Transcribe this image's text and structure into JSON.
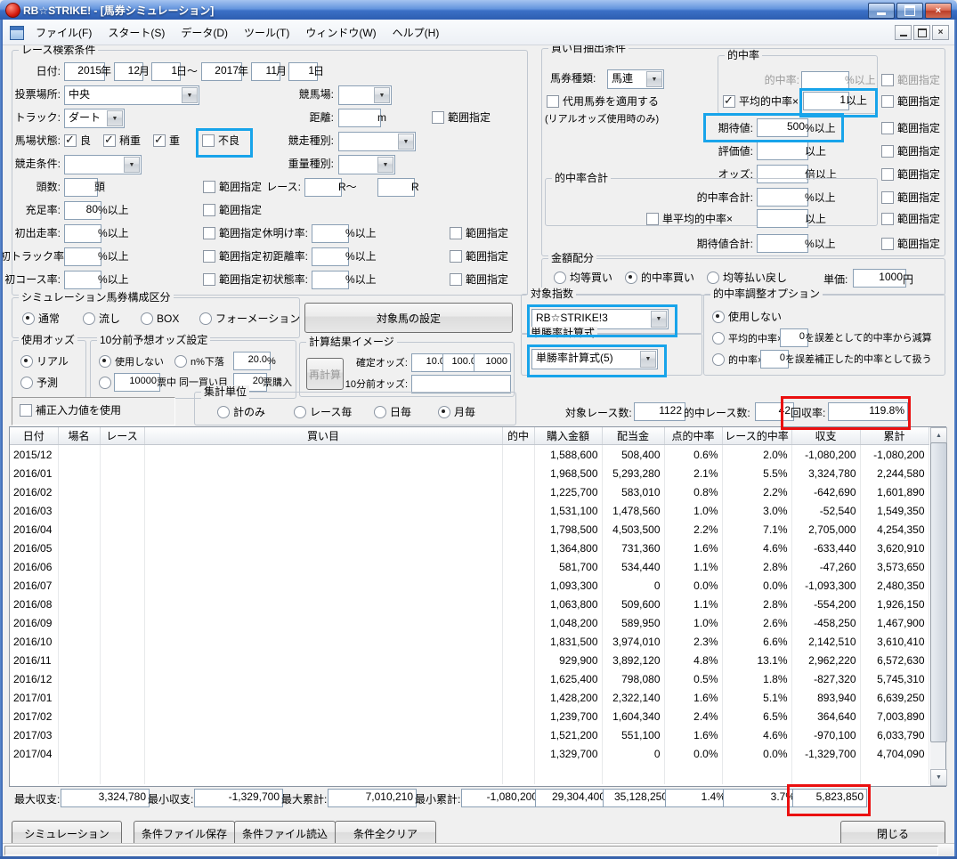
{
  "colors": {
    "highlight_blue": "#18a4ea",
    "highlight_red": "#ea1010",
    "titlebar_blue": "#3b70c6"
  },
  "titlebar": {
    "title": "RB☆STRIKE! - [馬券シミュレーション]"
  },
  "menubar": {
    "items": [
      "ファイル(F)",
      "スタート(S)",
      "データ(D)",
      "ツール(T)",
      "ウィンドウ(W)",
      "ヘルプ(H)"
    ]
  },
  "common": {
    "range": "範囲指定",
    "pct_above": "%以上",
    "above": "以上"
  },
  "race_search": {
    "legend": "レース検索条件",
    "date_label": "日付:",
    "from_year": "2015",
    "from_month": "12",
    "from_day": "1",
    "to_year": "2017",
    "to_month": "11",
    "to_day": "1",
    "unit_year": "年",
    "unit_month": "月",
    "unit_day_tilde": "日～",
    "unit_day": "日",
    "voting_label": "投票場所:",
    "voting_value": "中央",
    "keibajo_label": "競馬場:",
    "track_label": "トラック:",
    "track_value": "ダート",
    "distance_label": "距離:",
    "distance_unit": "m",
    "baba_label": "馬場状態:",
    "baba_good": "良",
    "baba_yaya": "稍重",
    "baba_omo": "重",
    "baba_furyo": "不良",
    "race_type_label": "競走種別:",
    "race_cond_label": "競走条件:",
    "weight_type_label": "重量種別:",
    "heads_label": "頭数:",
    "heads_unit": "頭",
    "race_label": "レース:",
    "race_from_unit": "R～",
    "race_to_unit": "R",
    "fill_label": "充足率:",
    "fill_value": "80",
    "first_run_label": "初出走率:",
    "rest_label": "休明け率:",
    "first_track_label": "初トラック率:",
    "first_dist_label": "初距離率:",
    "first_course_label": "初コース率:",
    "first_cond_label": "初状態率:"
  },
  "pick": {
    "legend": "買い目抽出条件",
    "ticket_label": "馬券種類:",
    "ticket_value": "馬連",
    "substitute_label": "代用馬券を適用する",
    "substitute_note": "(リアルオッズ使用時のみ)",
    "hitrate_legend": "的中率",
    "hitrate_label": "的中率:",
    "avg_hitrate_label": "平均的中率×",
    "avg_hitrate_value": "1",
    "expect_label": "期待値:",
    "expect_value": "500",
    "eval_label": "評価値:",
    "odds_label": "オッズ:",
    "odds_unit": "倍以上",
    "hitsum_legend": "的中率合計",
    "hitsum_label": "的中率合計:",
    "tanavg_label": "単平均的中率×",
    "expectsum_label": "期待値合計:"
  },
  "amount": {
    "legend": "金額配分",
    "equal_buy": "均等買い",
    "hitrate_buy": "的中率買い",
    "equal_payout": "均等払い戻し",
    "unit_label": "単価:",
    "unit_value": "1000",
    "unit_suffix": "円"
  },
  "composition": {
    "legend": "シミュレーション馬券構成区分",
    "normal": "通常",
    "nagashi": "流し",
    "box": "BOX",
    "formation": "フォーメーション",
    "target_button": "対象馬の設定"
  },
  "odds_use": {
    "legend": "使用オッズ",
    "real": "リアル",
    "predict": "予測"
  },
  "pre_odds": {
    "legend": "10分前予想オッズ設定",
    "not_use": "使用しない",
    "drop": "n%下落",
    "drop_value": "20.0",
    "drop_unit": "%",
    "votes_value": "10000",
    "votes_mid": "票中  同一買い目",
    "count_value": "20",
    "count_unit": "票購入"
  },
  "calc_image": {
    "legend": "計算結果イメージ",
    "recalc": "再計算",
    "fixed_label": "確定オッズ:",
    "fixed_values": [
      "10.0",
      "100.0",
      "1000"
    ],
    "pre_label": "10分前オッズ:"
  },
  "target_index": {
    "legend": "対象指数",
    "value": "RB☆STRIKE!3"
  },
  "win_formula": {
    "legend": "単勝率計算式",
    "value": "単勝率計算式(5)"
  },
  "adjust": {
    "legend": "的中率調整オプション",
    "not_use": "使用しない",
    "opt2_pre": "平均的中率×",
    "opt2_value": "0",
    "opt2_post": "を誤差として的中率から減算",
    "opt3_pre": "的中率×",
    "opt3_value": "0",
    "opt3_post": "を誤差補正した的中率として扱う"
  },
  "hosei": {
    "label": "補正入力値を使用"
  },
  "agg": {
    "legend": "集計単位",
    "total_only": "計のみ",
    "per_race": "レース毎",
    "per_day": "日毎",
    "per_month": "月毎"
  },
  "stats": {
    "races_label": "対象レース数:",
    "races_value": "1122",
    "hits_label": "的中レース数:",
    "hits_value": "42",
    "recovery_label": "回収率:",
    "recovery_value": "119.8%"
  },
  "table": {
    "headers": [
      "日付",
      "場名",
      "レース",
      "買い目",
      "的中",
      "購入金額",
      "配当金",
      "点的中率",
      "レース的中率",
      "収支",
      "累計"
    ],
    "rows": [
      [
        "2015/12",
        "",
        "",
        "",
        "",
        "1,588,600",
        "508,400",
        "0.6%",
        "2.0%",
        "-1,080,200",
        "-1,080,200"
      ],
      [
        "2016/01",
        "",
        "",
        "",
        "",
        "1,968,500",
        "5,293,280",
        "2.1%",
        "5.5%",
        "3,324,780",
        "2,244,580"
      ],
      [
        "2016/02",
        "",
        "",
        "",
        "",
        "1,225,700",
        "583,010",
        "0.8%",
        "2.2%",
        "-642,690",
        "1,601,890"
      ],
      [
        "2016/03",
        "",
        "",
        "",
        "",
        "1,531,100",
        "1,478,560",
        "1.0%",
        "3.0%",
        "-52,540",
        "1,549,350"
      ],
      [
        "2016/04",
        "",
        "",
        "",
        "",
        "1,798,500",
        "4,503,500",
        "2.2%",
        "7.1%",
        "2,705,000",
        "4,254,350"
      ],
      [
        "2016/05",
        "",
        "",
        "",
        "",
        "1,364,800",
        "731,360",
        "1.6%",
        "4.6%",
        "-633,440",
        "3,620,910"
      ],
      [
        "2016/06",
        "",
        "",
        "",
        "",
        "581,700",
        "534,440",
        "1.1%",
        "2.8%",
        "-47,260",
        "3,573,650"
      ],
      [
        "2016/07",
        "",
        "",
        "",
        "",
        "1,093,300",
        "0",
        "0.0%",
        "0.0%",
        "-1,093,300",
        "2,480,350"
      ],
      [
        "2016/08",
        "",
        "",
        "",
        "",
        "1,063,800",
        "509,600",
        "1.1%",
        "2.8%",
        "-554,200",
        "1,926,150"
      ],
      [
        "2016/09",
        "",
        "",
        "",
        "",
        "1,048,200",
        "589,950",
        "1.0%",
        "2.6%",
        "-458,250",
        "1,467,900"
      ],
      [
        "2016/10",
        "",
        "",
        "",
        "",
        "1,831,500",
        "3,974,010",
        "2.3%",
        "6.6%",
        "2,142,510",
        "3,610,410"
      ],
      [
        "2016/11",
        "",
        "",
        "",
        "",
        "929,900",
        "3,892,120",
        "4.8%",
        "13.1%",
        "2,962,220",
        "6,572,630"
      ],
      [
        "2016/12",
        "",
        "",
        "",
        "",
        "1,625,400",
        "798,080",
        "0.5%",
        "1.8%",
        "-827,320",
        "5,745,310"
      ],
      [
        "2017/01",
        "",
        "",
        "",
        "",
        "1,428,200",
        "2,322,140",
        "1.6%",
        "5.1%",
        "893,940",
        "6,639,250"
      ],
      [
        "2017/02",
        "",
        "",
        "",
        "",
        "1,239,700",
        "1,604,340",
        "2.4%",
        "6.5%",
        "364,640",
        "7,003,890"
      ],
      [
        "2017/03",
        "",
        "",
        "",
        "",
        "1,521,200",
        "551,100",
        "1.6%",
        "4.6%",
        "-970,100",
        "6,033,790"
      ],
      [
        "2017/04",
        "",
        "",
        "",
        "",
        "1,329,700",
        "0",
        "0.0%",
        "0.0%",
        "-1,329,700",
        "4,704,090"
      ]
    ]
  },
  "summary": {
    "max_balance_label": "最大収支:",
    "max_balance": "3,324,780",
    "min_balance_label": "最小収支:",
    "min_balance": "-1,329,700",
    "max_total_label": "最大累計:",
    "max_total": "7,010,210",
    "min_total_label": "最小累計:",
    "min_total": "-1,080,200",
    "purchase": "29,304,400",
    "payout": "35,128,250",
    "point_rate": "1.4%",
    "race_rate": "3.7%",
    "balance": "5,823,850"
  },
  "actions": {
    "simulation": "シミュレーション",
    "save": "条件ファイル保存",
    "load": "条件ファイル読込",
    "clear": "条件全クリア",
    "close": "閉じる"
  }
}
